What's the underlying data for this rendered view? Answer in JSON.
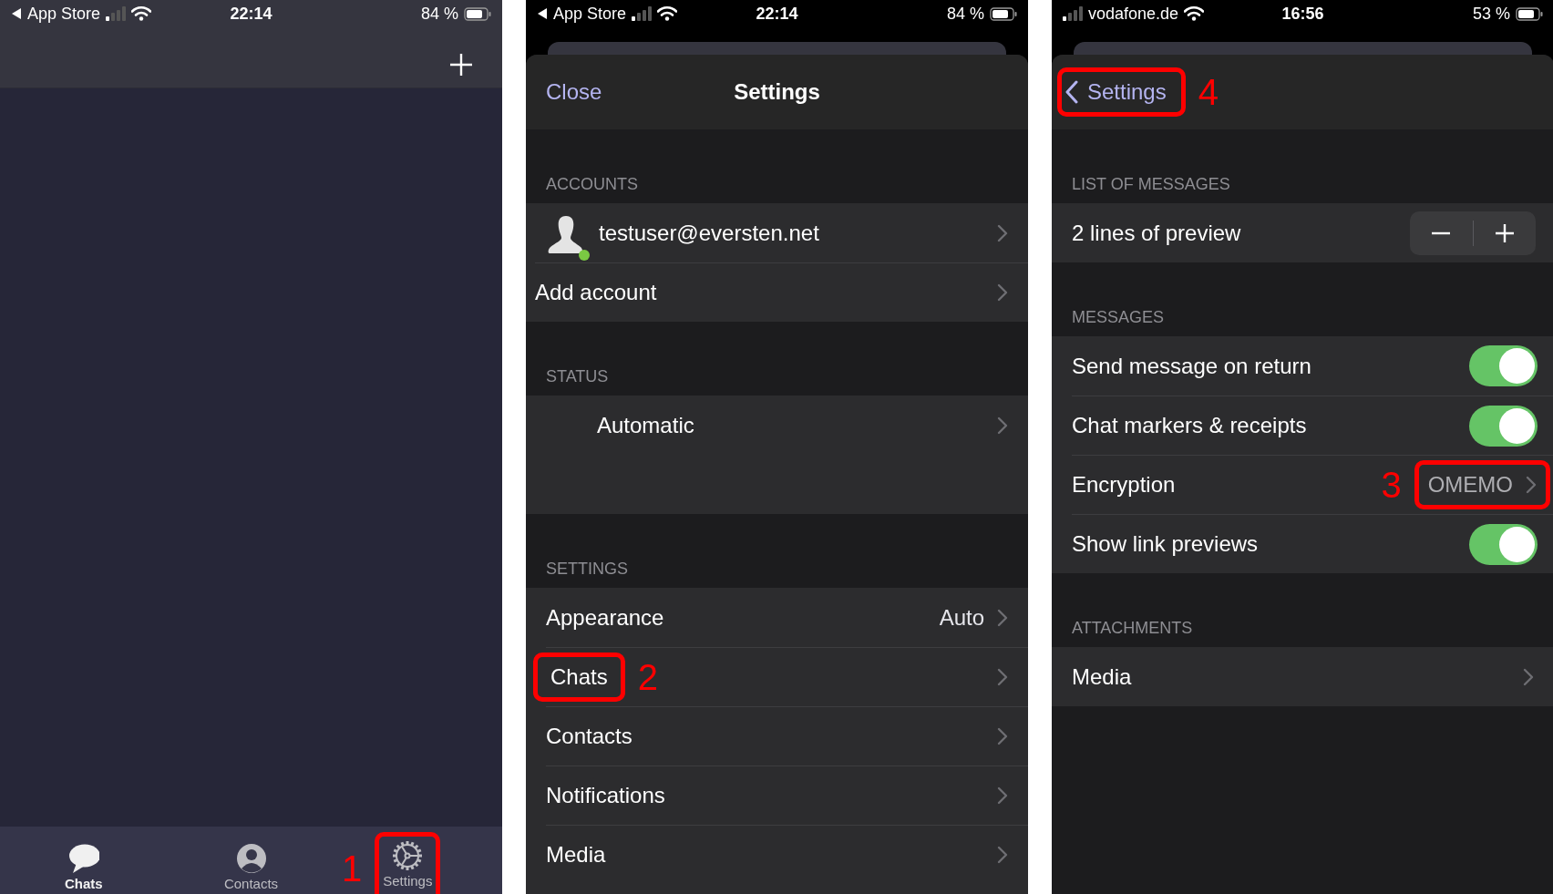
{
  "screens": [
    {
      "kind": "chats",
      "status_bar": {
        "back_to": "App Store",
        "time": "22:14",
        "battery": "84 %"
      },
      "tabs": [
        {
          "label": "Chats",
          "selected": true
        },
        {
          "label": "Contacts",
          "selected": false
        },
        {
          "label": "Settings",
          "selected": false,
          "callout": "1"
        }
      ]
    },
    {
      "kind": "sheet",
      "status_bar": {
        "back_to": "App Store",
        "time": "22:14",
        "battery": "84 %"
      },
      "header": {
        "close": "Close",
        "title": "Settings"
      },
      "sections": [
        {
          "title": "ACCOUNTS",
          "rows": [
            {
              "kind": "account",
              "label": "testuser@eversten.net",
              "online": true
            },
            {
              "kind": "flush",
              "label": "Add account"
            }
          ]
        },
        {
          "title": "STATUS",
          "rows": [
            {
              "kind": "status",
              "label": "Automatic"
            },
            {
              "kind": "empty"
            }
          ]
        },
        {
          "title": "SETTINGS",
          "rows": [
            {
              "kind": "link",
              "label": "Appearance",
              "value": "Auto"
            },
            {
              "kind": "link",
              "label": "Chats",
              "callout": "2"
            },
            {
              "kind": "link",
              "label": "Contacts"
            },
            {
              "kind": "link",
              "label": "Notifications"
            },
            {
              "kind": "link",
              "label": "Media"
            },
            {
              "kind": "empty"
            }
          ]
        }
      ]
    },
    {
      "kind": "sheet",
      "status_bar": {
        "carrier": "vodafone.de",
        "time": "16:56",
        "battery": "53 %"
      },
      "header": {
        "back": "Settings",
        "callout": "4"
      },
      "sections": [
        {
          "title": "LIST OF MESSAGES",
          "rows": [
            {
              "kind": "stepper",
              "label": "2 lines of preview"
            }
          ]
        },
        {
          "title": "MESSAGES",
          "rows": [
            {
              "kind": "toggle",
              "label": "Send message on return",
              "on": true
            },
            {
              "kind": "toggle",
              "label": "Chat markers & receipts",
              "on": true
            },
            {
              "kind": "link",
              "label": "Encryption",
              "value": "OMEMO",
              "value_callout": "3"
            },
            {
              "kind": "toggle",
              "label": "Show link previews",
              "on": true
            }
          ]
        },
        {
          "title": "ATTACHMENTS",
          "rows": [
            {
              "kind": "link",
              "label": "Media"
            }
          ]
        }
      ]
    }
  ]
}
